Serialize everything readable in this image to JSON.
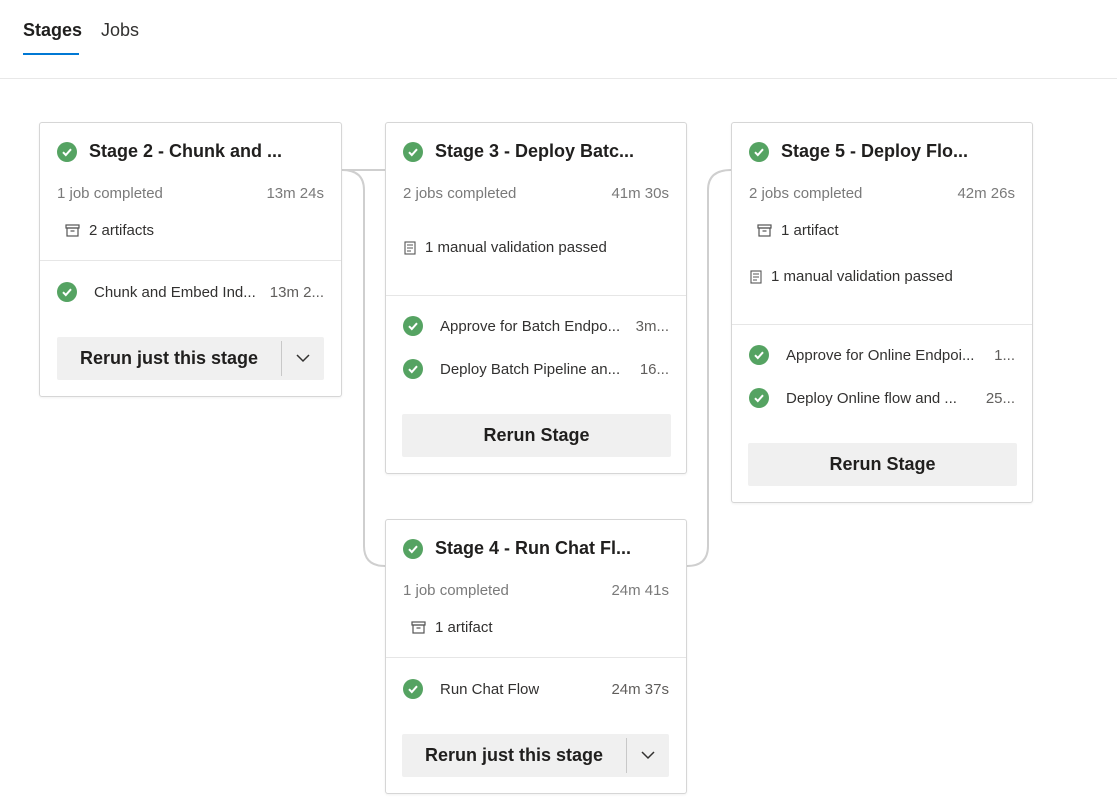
{
  "tabs": [
    {
      "label": "Stages",
      "active": true
    },
    {
      "label": "Jobs",
      "active": false
    }
  ],
  "colors": {
    "accent": "#0078d4",
    "success": "#55a362"
  },
  "stages": [
    {
      "title": "Stage 2 - Chunk and ...",
      "status": "succeeded",
      "summary": "1 job completed",
      "duration": "13m 24s",
      "details": [
        {
          "icon": "artifact-icon",
          "text": "2 artifacts"
        }
      ],
      "jobs": [
        {
          "name": "Chunk and Embed Ind...",
          "time": "13m 2..."
        }
      ],
      "button": {
        "label": "Rerun just this stage",
        "type": "split"
      }
    },
    {
      "title": "Stage 3 - Deploy Batc...",
      "status": "succeeded",
      "summary": "2 jobs completed",
      "duration": "41m 30s",
      "details": [
        {
          "icon": "checklist-icon",
          "text": "1 manual validation passed"
        }
      ],
      "jobs": [
        {
          "name": "Approve for Batch Endpo...",
          "time": "3m..."
        },
        {
          "name": "Deploy Batch Pipeline an...",
          "time": "16..."
        }
      ],
      "button": {
        "label": "Rerun Stage",
        "type": "plain"
      }
    },
    {
      "title": "Stage 5 - Deploy Flo...",
      "status": "succeeded",
      "summary": "2 jobs completed",
      "duration": "42m 26s",
      "details": [
        {
          "icon": "artifact-icon",
          "text": "1 artifact"
        },
        {
          "icon": "checklist-icon",
          "text": "1 manual validation passed"
        }
      ],
      "jobs": [
        {
          "name": "Approve for Online Endpoi...",
          "time": "1..."
        },
        {
          "name": "Deploy Online flow and ...",
          "time": "25..."
        }
      ],
      "button": {
        "label": "Rerun Stage",
        "type": "plain"
      }
    },
    {
      "title": "Stage 4 - Run Chat Fl...",
      "status": "succeeded",
      "summary": "1 job completed",
      "duration": "24m 41s",
      "details": [
        {
          "icon": "artifact-icon",
          "text": "1 artifact"
        }
      ],
      "jobs": [
        {
          "name": "Run Chat Flow",
          "time": "24m 37s"
        }
      ],
      "button": {
        "label": "Rerun just this stage",
        "type": "split"
      }
    }
  ]
}
